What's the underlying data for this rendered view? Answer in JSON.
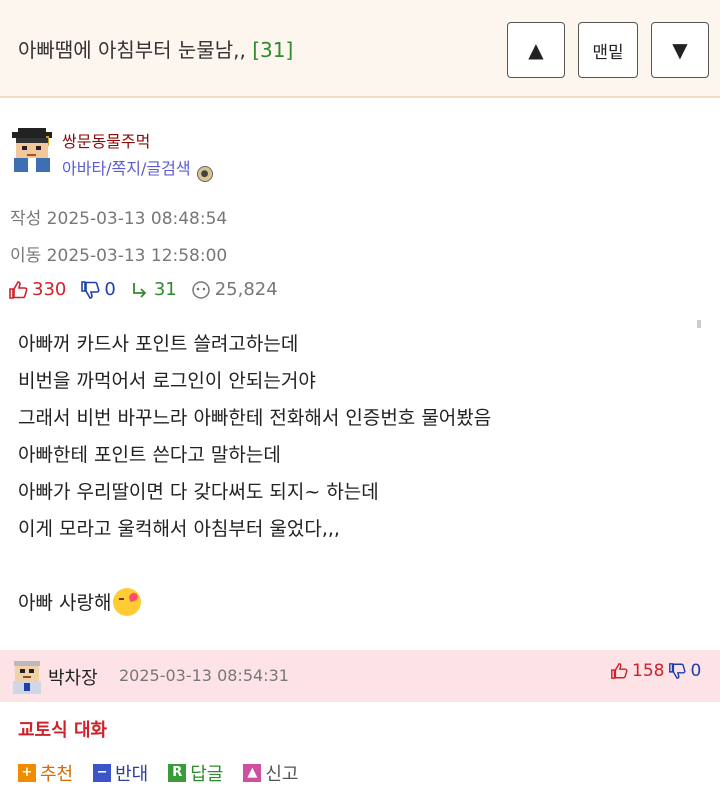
{
  "header": {
    "title": "아빠땜에 아침부터 눈물남,,",
    "reply_count": "[31]",
    "up_icon": "triangle-up-icon",
    "bottom_label": "맨밑",
    "down_icon": "triangle-down-icon"
  },
  "post": {
    "author": "쌍문동물주먹",
    "author_links": "아바타/쪽지/글검색",
    "written": "작성 2025-03-13 08:48:54",
    "moved": "이동 2025-03-13 12:58:00",
    "stats": {
      "upvotes": "330",
      "downvotes": "0",
      "replies": "31",
      "views": "25,824"
    },
    "body_lines": [
      "아빠꺼 카드사 포인트 쓸려고하는데",
      "비번을 까먹어서 로그인이 안되는거야",
      "그래서 비번 바꾸느라 아빠한테 전화해서 인증번호 물어봤음",
      "아빠한테 포인트 쓴다고 말하는데",
      "아빠가 우리딸이면 다 갖다써도 되지~ 하는데",
      "이게 모라고 울컥해서 아침부터 울었다,,,",
      "",
      "아빠 사랑해"
    ]
  },
  "comment": {
    "author": "박차장",
    "time": "2025-03-13 08:54:31",
    "upvotes": "158",
    "downvotes": "0",
    "text": "교토식 대화",
    "actions": {
      "recommend": "추천",
      "oppose": "반대",
      "reply": "답글",
      "report": "신고"
    }
  },
  "colors": {
    "header_bg": "#fdf6ee",
    "author": "#8b0a0a",
    "links": "#5b5bd6",
    "upvote": "#d0202a",
    "downvote": "#1e3fae",
    "reply": "#2e8b2e",
    "comment_bg": "#fde3e6"
  }
}
